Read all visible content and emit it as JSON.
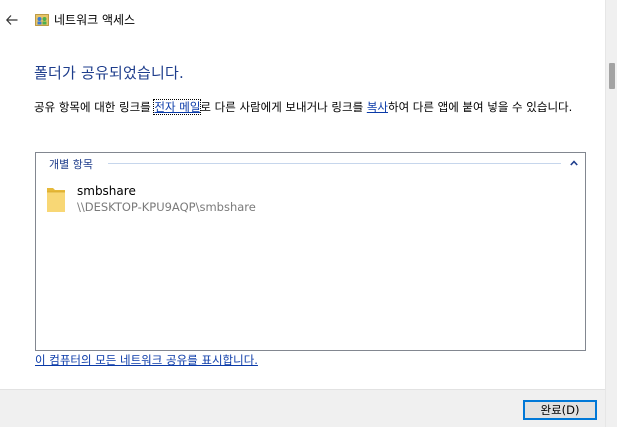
{
  "titlebar": {
    "title": "네트워크 액세스",
    "back_icon": "back-arrow-icon",
    "app_icon": "network-icon"
  },
  "main": {
    "heading": "폴더가 공유되었습니다.",
    "description": {
      "part1": "공유 항목에 대한 링크를 ",
      "email_link": "전자 메일",
      "part2": "로 다른 사람에게 보내거나 링크를 ",
      "copy_link": "복사",
      "part3": "하여 다른 앱에 붙여 넣을 수 있습니다."
    },
    "group": {
      "label": "개별 항목",
      "collapse_icon": "chevron-up-icon",
      "items": [
        {
          "name": "smbshare",
          "path": "\\\\DESKTOP-KPU9AQP\\smbshare",
          "icon": "folder-icon"
        }
      ]
    },
    "show_all_link": "이 컴퓨터의 모든 네트워크 공유를 표시합니다."
  },
  "footer": {
    "done_label": "완료(D)"
  },
  "colors": {
    "heading": "#1e3d8c",
    "link": "#0a3aa8",
    "button_border": "#0078d7",
    "footer_bg": "#f0f0f0"
  }
}
